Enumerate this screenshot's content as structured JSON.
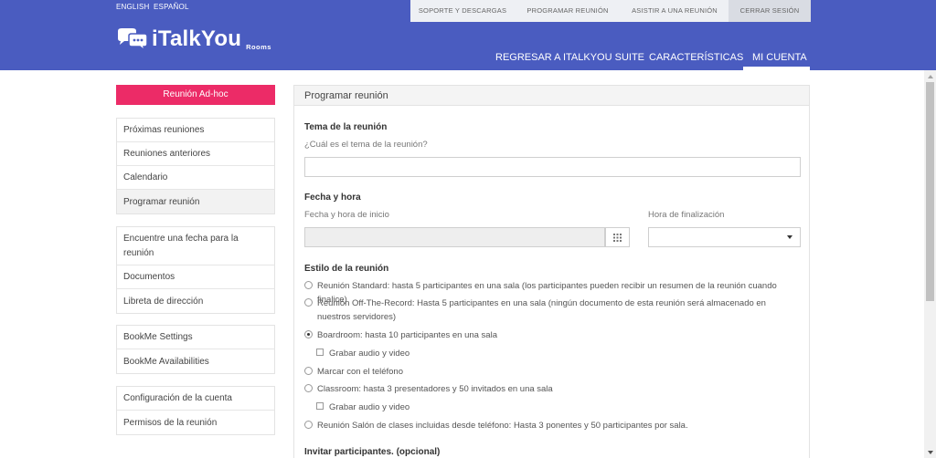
{
  "header": {
    "lang": [
      "ENGLISH",
      "ESPAÑOL"
    ],
    "top_links": [
      "SOPORTE Y DESCARGAS",
      "PROGRAMAR REUNIÓN",
      "ASISTIR A UNA REUNIÓN",
      "CERRAR SESIÓN"
    ],
    "logo_text": "iTalkYou",
    "logo_sub": "Rooms",
    "main_nav": [
      "REGRESAR A ITALKYOU SUITE",
      "CARACTERÍSTICAS",
      "MI CUENTA"
    ],
    "brand_color": "#4a5cc0"
  },
  "sidebar": {
    "adhoc_label": "Reunión Ad-hoc",
    "adhoc_color": "#ec2b67",
    "group1": [
      "Próximas reuniones",
      "Reuniones anteriores",
      "Calendario",
      "Programar reunión"
    ],
    "group2": [
      "Encuentre una fecha para la reunión",
      "Documentos",
      "Libreta de dirección"
    ],
    "group3": [
      "BookMe Settings",
      "BookMe Availabilities"
    ],
    "group4": [
      "Configuración de la cuenta",
      "Permisos de la reunión"
    ]
  },
  "main": {
    "title": "Programar reunión",
    "topic": {
      "heading": "Tema de la reunión",
      "question": "¿Cuál es el tema de la reunión?",
      "value": ""
    },
    "datetime": {
      "heading": "Fecha y hora",
      "start_label": "Fecha y hora de inicio",
      "end_label": "Hora de finalización",
      "start_value": "",
      "end_value": ""
    },
    "style": {
      "heading": "Estilo de la reunión",
      "options": [
        "Reunión Standard: hasta 5 participantes en una sala (los participantes pueden recibir un resumen de la reunión cuando finalice)",
        "Reunión Off-The-Record: Hasta 5 participantes en una sala (ningún documento de esta reunión será almacenado en nuestros servidores)",
        "Boardroom: hasta 10 participantes en una sala",
        "Grabar audio y video",
        "Marcar con el teléfono",
        "Classroom: hasta 3 presentadores y 50 invitados en una sala",
        "Grabar audio y video",
        "Reunión Salón de clases incluidas desde teléfono: Hasta 3 ponentes y 50 participantes por sala."
      ],
      "selected": "Boardroom: hasta 10 participantes en una sala"
    },
    "invite_heading": "Invitar participantes. (opcional)"
  }
}
